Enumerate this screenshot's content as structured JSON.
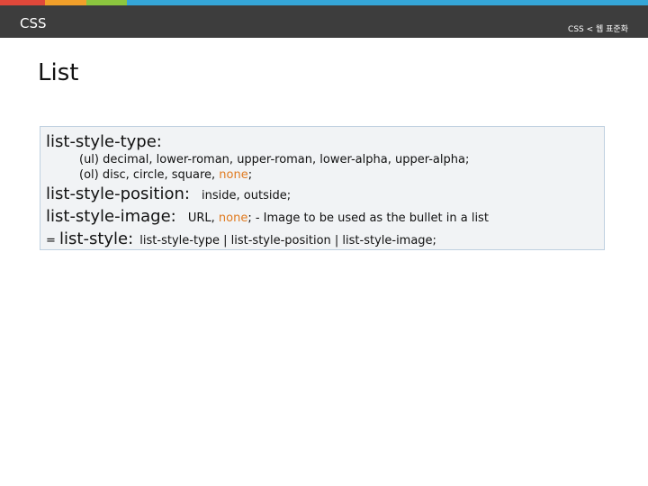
{
  "header": {
    "left_label": "CSS",
    "right_label": "CSS < 웹 표준화",
    "stripe_colors": [
      "#e0483a",
      "#f19f2a",
      "#8cc63f",
      "#35a6d8"
    ]
  },
  "title": "List",
  "content": {
    "line1": "list-style-type:",
    "line2": "(ul) decimal, lower-roman, upper-roman, lower-alpha, upper-alpha;",
    "line3_pre": "(ol) disc, circle, square, ",
    "line3_hl": "none",
    "line3_post": ";",
    "line4_label": "list-style-position:",
    "line4_value": "inside, outside;",
    "line5_label": "list-style-image:",
    "line5_pre": "URL, ",
    "line5_hl": "none",
    "line5_post": "; - Image to be used as the bullet in a list",
    "line6_prefix": "= ",
    "line6_label": "list-style:",
    "line6_value": "list-style-type | list-style-position | list-style-image;"
  }
}
